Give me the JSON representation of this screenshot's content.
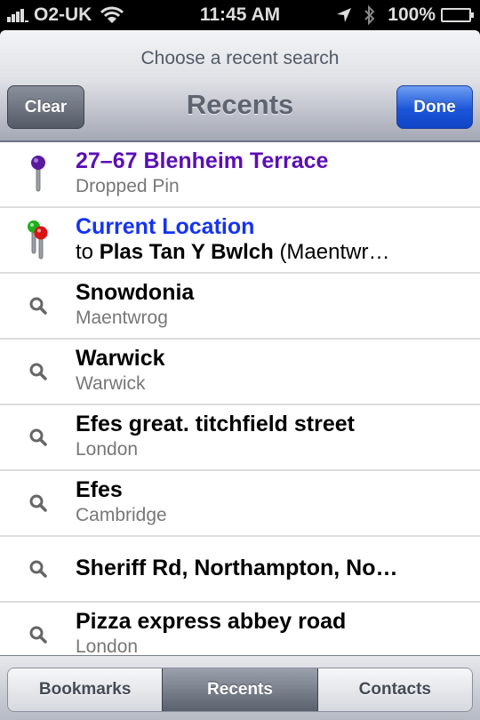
{
  "status_bar": {
    "carrier": "O2-UK",
    "time": "11:45 AM",
    "battery": "100%",
    "battery_level": 1.0,
    "icons": [
      "signal-icon",
      "wifi-icon",
      "location-arrow-icon",
      "bluetooth-icon",
      "battery-icon"
    ]
  },
  "nav": {
    "prompt": "Choose a recent search",
    "title": "Recents",
    "clear_label": "Clear",
    "done_label": "Done"
  },
  "colors": {
    "dropped_pin_title": "#5b0fb5",
    "current_location": "#1433f5",
    "done_button": "#1b56d9"
  },
  "recents": [
    {
      "icon": "purple-pin-icon",
      "title": "27–67 Blenheim Terrace",
      "subtitle": "Dropped Pin"
    },
    {
      "icon": "route-pins-icon",
      "title": "Current Location",
      "subtitle_prefix": "to",
      "subtitle_bold": "Plas Tan Y Bwlch",
      "subtitle_suffix": "(Maentwr…"
    },
    {
      "icon": "search-icon",
      "title": "Snowdonia",
      "subtitle": "Maentwrog"
    },
    {
      "icon": "search-icon",
      "title": "Warwick",
      "subtitle": "Warwick"
    },
    {
      "icon": "search-icon",
      "title": "Efes great. titchfield street",
      "subtitle": "London"
    },
    {
      "icon": "search-icon",
      "title": "Efes",
      "subtitle": "Cambridge"
    },
    {
      "icon": "search-icon",
      "title": "Sheriff Rd, Northampton, No…"
    },
    {
      "icon": "search-icon",
      "title": "Pizza express abbey road",
      "subtitle": "London"
    }
  ],
  "tabs": [
    {
      "label": "Bookmarks",
      "active": false
    },
    {
      "label": "Recents",
      "active": true
    },
    {
      "label": "Contacts",
      "active": false
    }
  ]
}
